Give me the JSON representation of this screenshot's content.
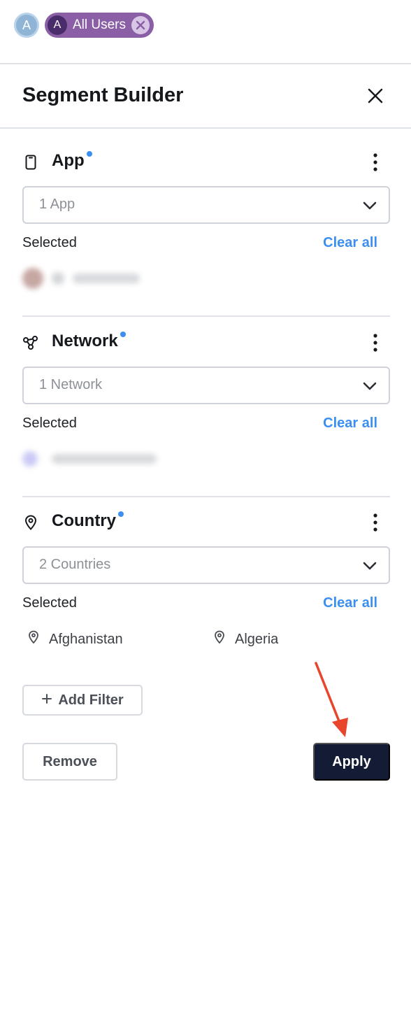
{
  "chips": {
    "solo_avatar_letter": "A",
    "segment_avatar_letter": "A",
    "segment_label": "All Users"
  },
  "panel": {
    "title": "Segment Builder"
  },
  "sections": [
    {
      "title": "App",
      "icon": "phone-icon",
      "select_value": "1 App",
      "selected_label": "Selected",
      "clear_label": "Clear all"
    },
    {
      "title": "Network",
      "icon": "network-icon",
      "select_value": "1 Network",
      "selected_label": "Selected",
      "clear_label": "Clear all"
    },
    {
      "title": "Country",
      "icon": "location-pin-icon",
      "select_value": "2 Countries",
      "selected_label": "Selected",
      "clear_label": "Clear all",
      "selected_items": [
        "Afghanistan",
        "Algeria"
      ]
    }
  ],
  "actions": {
    "add_filter": "Add Filter",
    "remove": "Remove",
    "apply": "Apply"
  },
  "colors": {
    "chip": "#8a5fa6",
    "accent": "#3b8ff0",
    "apply_button": "#141b34",
    "annotation_arrow": "#e8452c"
  }
}
